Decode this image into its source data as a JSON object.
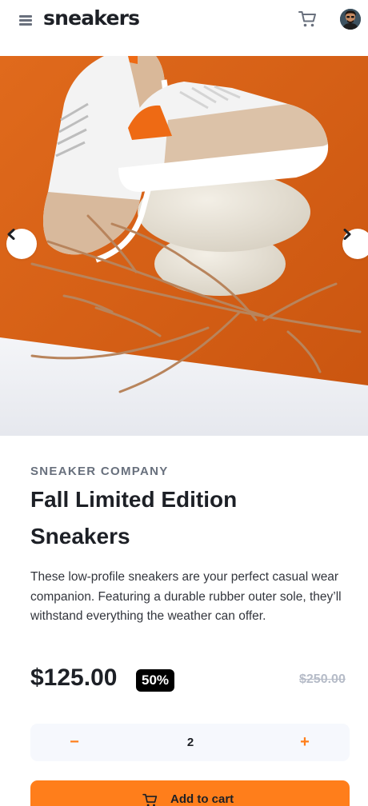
{
  "header": {
    "logo": "sneakers",
    "menu_icon": "hamburger-menu-icon",
    "cart_icon": "cart-icon",
    "avatar": "user-avatar"
  },
  "gallery": {
    "prev_icon": "chevron-left-icon",
    "next_icon": "chevron-right-icon"
  },
  "product": {
    "company": "SNEAKER COMPANY",
    "title": "Fall Limited Edition Sneakers",
    "description": "These low-profile sneakers are your perfect casual wear companion. Featuring a durable rubber outer sole, they’ll withstand everything the weather can offer.",
    "price": "$125.00",
    "discount": "50%",
    "original_price": "$250.00"
  },
  "quantity": {
    "minus": "−",
    "value": "2",
    "plus": "+"
  },
  "cta": {
    "label": "Add to cart",
    "icon": "cart-icon"
  },
  "colors": {
    "accent": "#ff7e1b",
    "text": "#1d2026",
    "muted": "#68707d",
    "light_bg": "#f6f8fd"
  }
}
